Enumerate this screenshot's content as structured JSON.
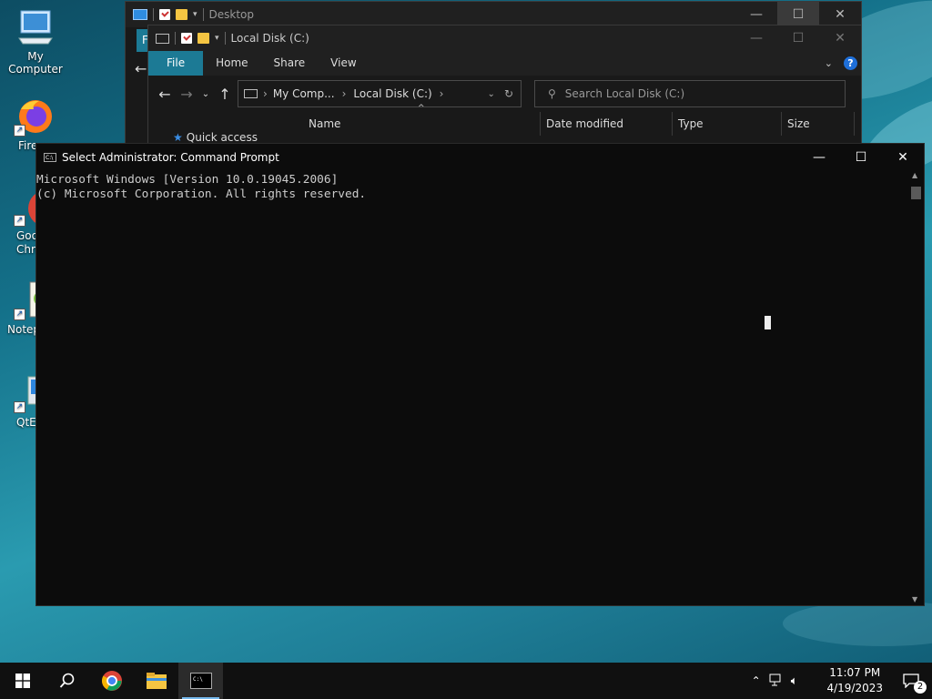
{
  "desktop": {
    "icons": [
      {
        "label": "My Computer",
        "icon": "monitor-icon"
      },
      {
        "label": "Fire",
        "icon": "firefox-icon"
      },
      {
        "label": "Goo\nChro",
        "icon": "chrome-icon"
      },
      {
        "label": "Notep",
        "icon": "notepad-icon"
      },
      {
        "label": "QtE",
        "icon": "qt-icon"
      }
    ]
  },
  "explorer_desktop": {
    "title": "Desktop",
    "ribbon_file": "F"
  },
  "explorer_disk": {
    "title": "Local Disk (C:)",
    "ribbon_tabs": [
      "File",
      "Home",
      "Share",
      "View"
    ],
    "address": {
      "crumbs": [
        "My Comp...",
        "Local Disk (C:)"
      ]
    },
    "search_placeholder": "Search Local Disk (C:)",
    "columns": [
      "Name",
      "Date modified",
      "Type",
      "Size"
    ],
    "nav_quick_access": "Quick access"
  },
  "cmd": {
    "title": "Select Administrator: Command Prompt",
    "lines": [
      "Microsoft Windows [Version 10.0.19045.2006]",
      "(c) Microsoft Corporation. All rights reserved."
    ]
  },
  "taskbar": {
    "apps": [
      "start-icon",
      "search-icon",
      "chrome-icon",
      "file-explorer-icon",
      "cmd-icon"
    ],
    "time": "11:07 PM",
    "date": "4/19/2023",
    "notifications": "2"
  },
  "colors": {
    "accent": "#1c7a95",
    "taskbar_highlight": "#76b9ed",
    "cmd_bg": "#0c0c0c"
  }
}
